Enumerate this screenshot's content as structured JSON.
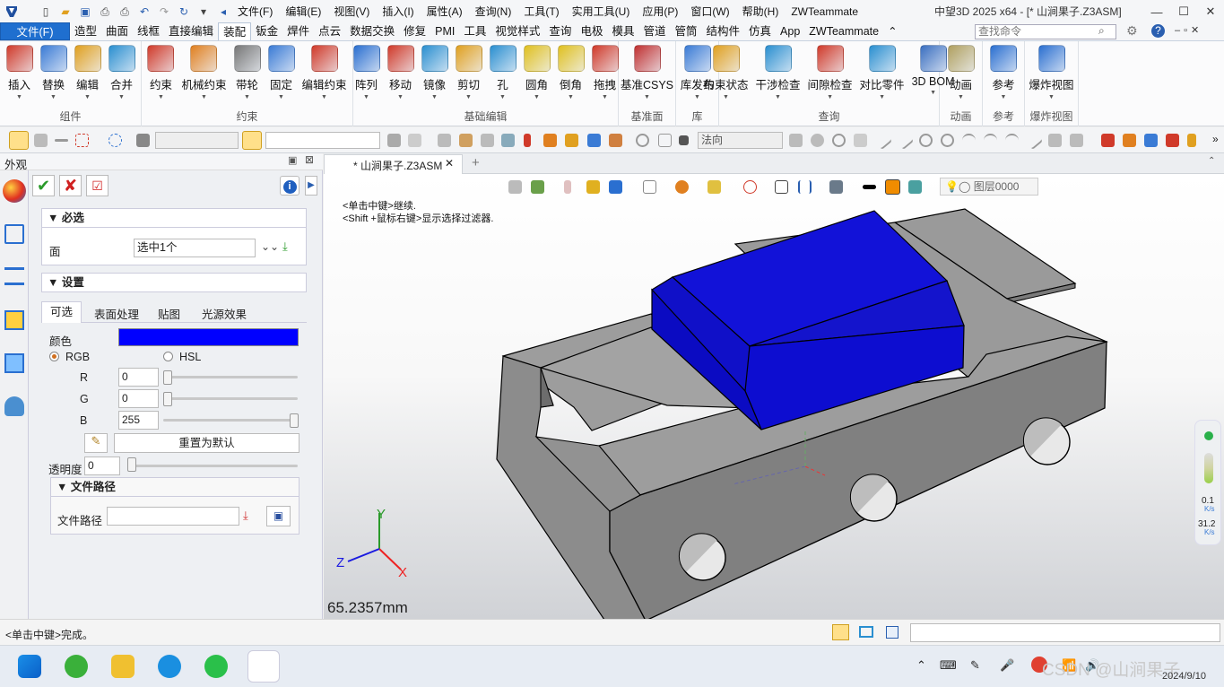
{
  "titlebar": {
    "menus": [
      "文件(F)",
      "编辑(E)",
      "视图(V)",
      "插入(I)",
      "属性(A)",
      "查询(N)",
      "工具(T)",
      "实用工具(U)",
      "应用(P)",
      "窗口(W)",
      "帮助(H)",
      "ZWTeammate"
    ],
    "window_title": "中望3D 2025 x64 - [* 山涧果子.Z3ASM]"
  },
  "ribbon_tabs": [
    "文件(F)",
    "造型",
    "曲面",
    "线框",
    "直接编辑",
    "装配",
    "钣金",
    "焊件",
    "点云",
    "数据交换",
    "修复",
    "PMI",
    "工具",
    "视觉样式",
    "查询",
    "电极",
    "模具",
    "管道",
    "管筒",
    "结构件",
    "仿真",
    "App",
    "ZWTeammate"
  ],
  "active_tab": "装配",
  "command_search": {
    "placeholder": "查找命令"
  },
  "ribbon_groups": [
    {
      "title": "组件",
      "buttons": [
        {
          "label": "插入",
          "icon": "insert-component-icon",
          "color": "#d03a2a"
        },
        {
          "label": "替换",
          "icon": "replace-icon",
          "color": "#3a7bd5"
        },
        {
          "label": "编辑",
          "icon": "edit-component-icon",
          "color": "#e0a020"
        },
        {
          "label": "合并",
          "icon": "merge-icon",
          "color": "#2a8fd0"
        }
      ]
    },
    {
      "title": "约束",
      "buttons": [
        {
          "label": "约束",
          "icon": "constraint-icon",
          "color": "#d03a2a"
        },
        {
          "label": "机械约束",
          "icon": "mech-constraint-icon",
          "color": "#e08020"
        },
        {
          "label": "带轮",
          "icon": "pulley-icon",
          "color": "#777777"
        },
        {
          "label": "固定",
          "icon": "fix-icon",
          "color": "#3a7bd5"
        },
        {
          "label": "编辑约束",
          "icon": "edit-constraint-icon",
          "color": "#d03a2a"
        }
      ]
    },
    {
      "title": "基础编辑",
      "buttons": [
        {
          "label": "阵列",
          "icon": "array-icon",
          "color": "#2a6fd0"
        },
        {
          "label": "移动",
          "icon": "move-icon",
          "color": "#d03a2a"
        },
        {
          "label": "镜像",
          "icon": "mirror-icon",
          "color": "#2a8fd0"
        },
        {
          "label": "剪切",
          "icon": "cut-icon",
          "color": "#e0a020"
        },
        {
          "label": "孔",
          "icon": "hole-icon",
          "color": "#2a8fd0"
        },
        {
          "label": "圆角",
          "icon": "fillet-icon",
          "color": "#e0c020"
        },
        {
          "label": "倒角",
          "icon": "chamfer-icon",
          "color": "#e0c020"
        },
        {
          "label": "拖拽",
          "icon": "drag-icon",
          "color": "#d03a2a"
        }
      ]
    },
    {
      "title": "基准面",
      "buttons": [
        {
          "label": "基准CSYS",
          "icon": "csys-icon",
          "color": "#c03030"
        }
      ]
    },
    {
      "title": "库",
      "buttons": [
        {
          "label": "库发布",
          "icon": "library-publish-icon",
          "color": "#3a7bd5"
        }
      ]
    },
    {
      "title": "查询",
      "buttons": [
        {
          "label": "约束状态",
          "icon": "constraint-status-icon",
          "color": "#e0a020"
        },
        {
          "label": "干涉检查",
          "icon": "interference-icon",
          "color": "#2a8fd0"
        },
        {
          "label": "间隙检查",
          "icon": "clearance-icon",
          "color": "#d03a2a"
        },
        {
          "label": "对比零件",
          "icon": "compare-icon",
          "color": "#2a8fd0"
        },
        {
          "label": "3D BOM",
          "icon": "bom-icon",
          "color": "#3a6fc0"
        }
      ]
    },
    {
      "title": "动画",
      "buttons": [
        {
          "label": "动画",
          "icon": "animation-icon",
          "color": "#b0a060"
        }
      ]
    },
    {
      "title": "参考",
      "buttons": [
        {
          "label": "参考",
          "icon": "reference-icon",
          "color": "#2a6fd0"
        }
      ]
    },
    {
      "title": "爆炸视图",
      "buttons": [
        {
          "label": "爆炸视图",
          "icon": "explode-icon",
          "color": "#2a6fd0"
        }
      ]
    }
  ],
  "toolbar2": {
    "filter_value": "法向"
  },
  "panel": {
    "title": "外观",
    "required_section": "必选",
    "face_label": "面",
    "face_value": "选中1个",
    "settings_section": "设置",
    "tabs": [
      "可选",
      "表面处理",
      "贴图",
      "光源效果"
    ],
    "color_label": "颜色",
    "color_value": "#0000ff",
    "mode_rgb": "RGB",
    "mode_hsl": "HSL",
    "r_label": "R",
    "r_value": "0",
    "r_fraction": 0,
    "g_label": "G",
    "g_value": "0",
    "g_fraction": 0,
    "b_label": "B",
    "b_value": "255",
    "b_fraction": 1,
    "reset_label": "重置为默认",
    "transparency_label": "透明度",
    "transparency_value": "0",
    "filepath_section": "文件路径",
    "filepath_label": "文件路径"
  },
  "document": {
    "tab_label": "* 山涧果子.Z3ASM",
    "hint1": "<单击中键>继续.",
    "hint2": "<Shift +鼠标右键>显示选择过滤器.",
    "layer": "图层0000",
    "scale": "65.2357mm",
    "axis_x": "X",
    "axis_y": "Y",
    "axis_z": "Z"
  },
  "perf_widget": {
    "val1": "0.1",
    "unit1": "K/s",
    "val2": "31.2",
    "unit2": "K/s"
  },
  "statusbar": {
    "message": "<单击中键>完成。"
  },
  "taskbar": {
    "date": "2024/9/10",
    "watermark": "CSDN @山涧果子"
  }
}
